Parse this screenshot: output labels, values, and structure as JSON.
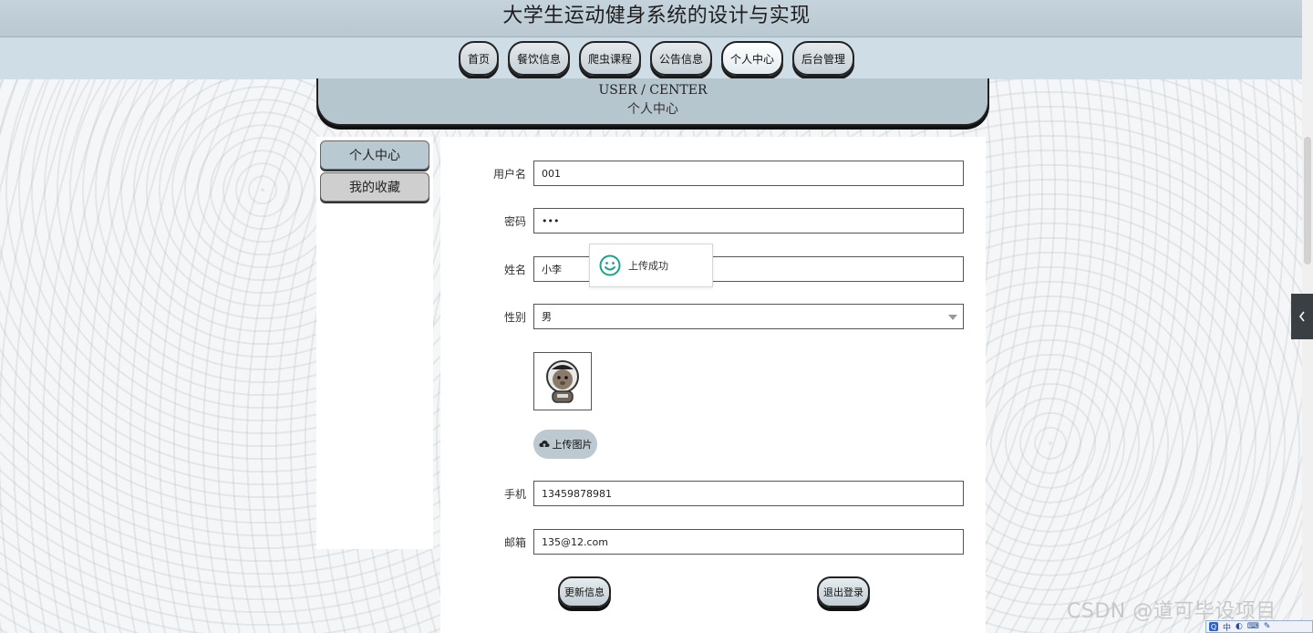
{
  "header": {
    "title": "大学生运动健身系统的设计与实现"
  },
  "nav": {
    "items": [
      "首页",
      "餐饮信息",
      "爬虫课程",
      "公告信息",
      "个人中心",
      "后台管理"
    ],
    "active_index": 4
  },
  "banner": {
    "en": "USER / CENTER",
    "cn": "个人中心"
  },
  "sidebar": {
    "items": [
      "个人中心",
      "我的收藏"
    ],
    "active_index": 0
  },
  "form": {
    "username": {
      "label": "用户名",
      "value": "001"
    },
    "password": {
      "label": "密码",
      "value": "•••"
    },
    "name": {
      "label": "姓名",
      "value": "小李"
    },
    "gender": {
      "label": "性别",
      "value": "男"
    },
    "upload_label": "上传图片",
    "phone": {
      "label": "手机",
      "value": "13459878981"
    },
    "email": {
      "label": "邮箱",
      "value": "135@12.com"
    },
    "update_label": "更新信息",
    "logout_label": "退出登录"
  },
  "toast": {
    "message": "上传成功",
    "icon": "smile-icon",
    "color": "#1aa38a"
  },
  "watermark": "CSDN @道可毕设项目",
  "ime": {
    "badge": "Q",
    "mode": "中"
  }
}
